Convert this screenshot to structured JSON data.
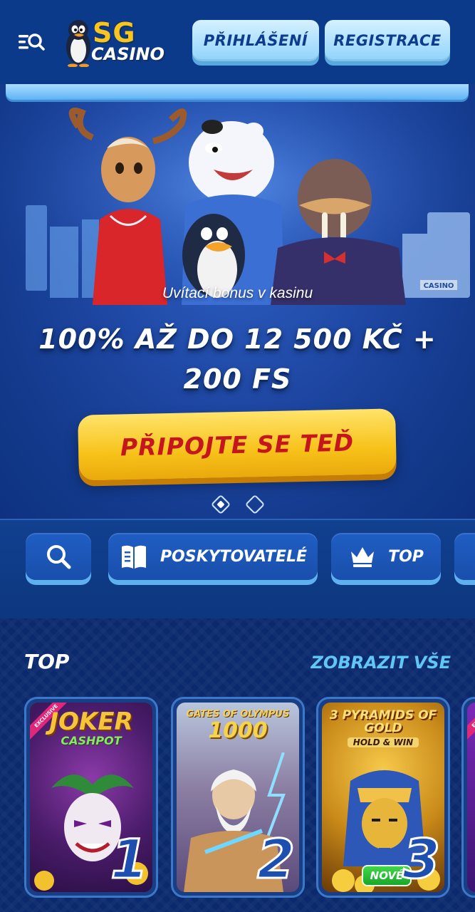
{
  "header": {
    "logo_top": "SG",
    "logo_bottom": "CASINO",
    "login_label": "PŘIHLÁŠENÍ",
    "register_label": "REGISTRACE"
  },
  "hero": {
    "subtitle": "Uvítací bonus v kasinu",
    "title": "100% AŽ DO 12 500 KČ + 200 FS",
    "cta_label": "PŘIPOJTE SE TEĎ",
    "building_sign": "CASINO",
    "slide_count": 2,
    "active_slide": 1
  },
  "nav_chips": {
    "providers_label": "POSKYTOVATELÉ",
    "top_label": "TOP"
  },
  "top_section": {
    "title": "TOP",
    "view_all_label": "ZOBRAZIT VŠE",
    "games": [
      {
        "title_line1": "JOKER",
        "title_line2": "CASHPOT",
        "rank": "1",
        "badge": "EXCLUSIVE"
      },
      {
        "title_line1": "GATES OF OLYMPUS",
        "title_line2": "1000",
        "rank": "2"
      },
      {
        "title_line1": "3 PYRAMIDS OF GOLD",
        "title_line2": "HOLD & WIN",
        "rank": "3",
        "badge": "NOVÉ"
      },
      {
        "badge": "EXCLUSIVE"
      }
    ]
  },
  "colors": {
    "header_bg": "#0b3a8a",
    "cta_yellow": "#f7c21a",
    "cta_text_red": "#c5161d",
    "link_cyan": "#62c6f5",
    "header_button_light_blue": "#8fd3fb"
  }
}
